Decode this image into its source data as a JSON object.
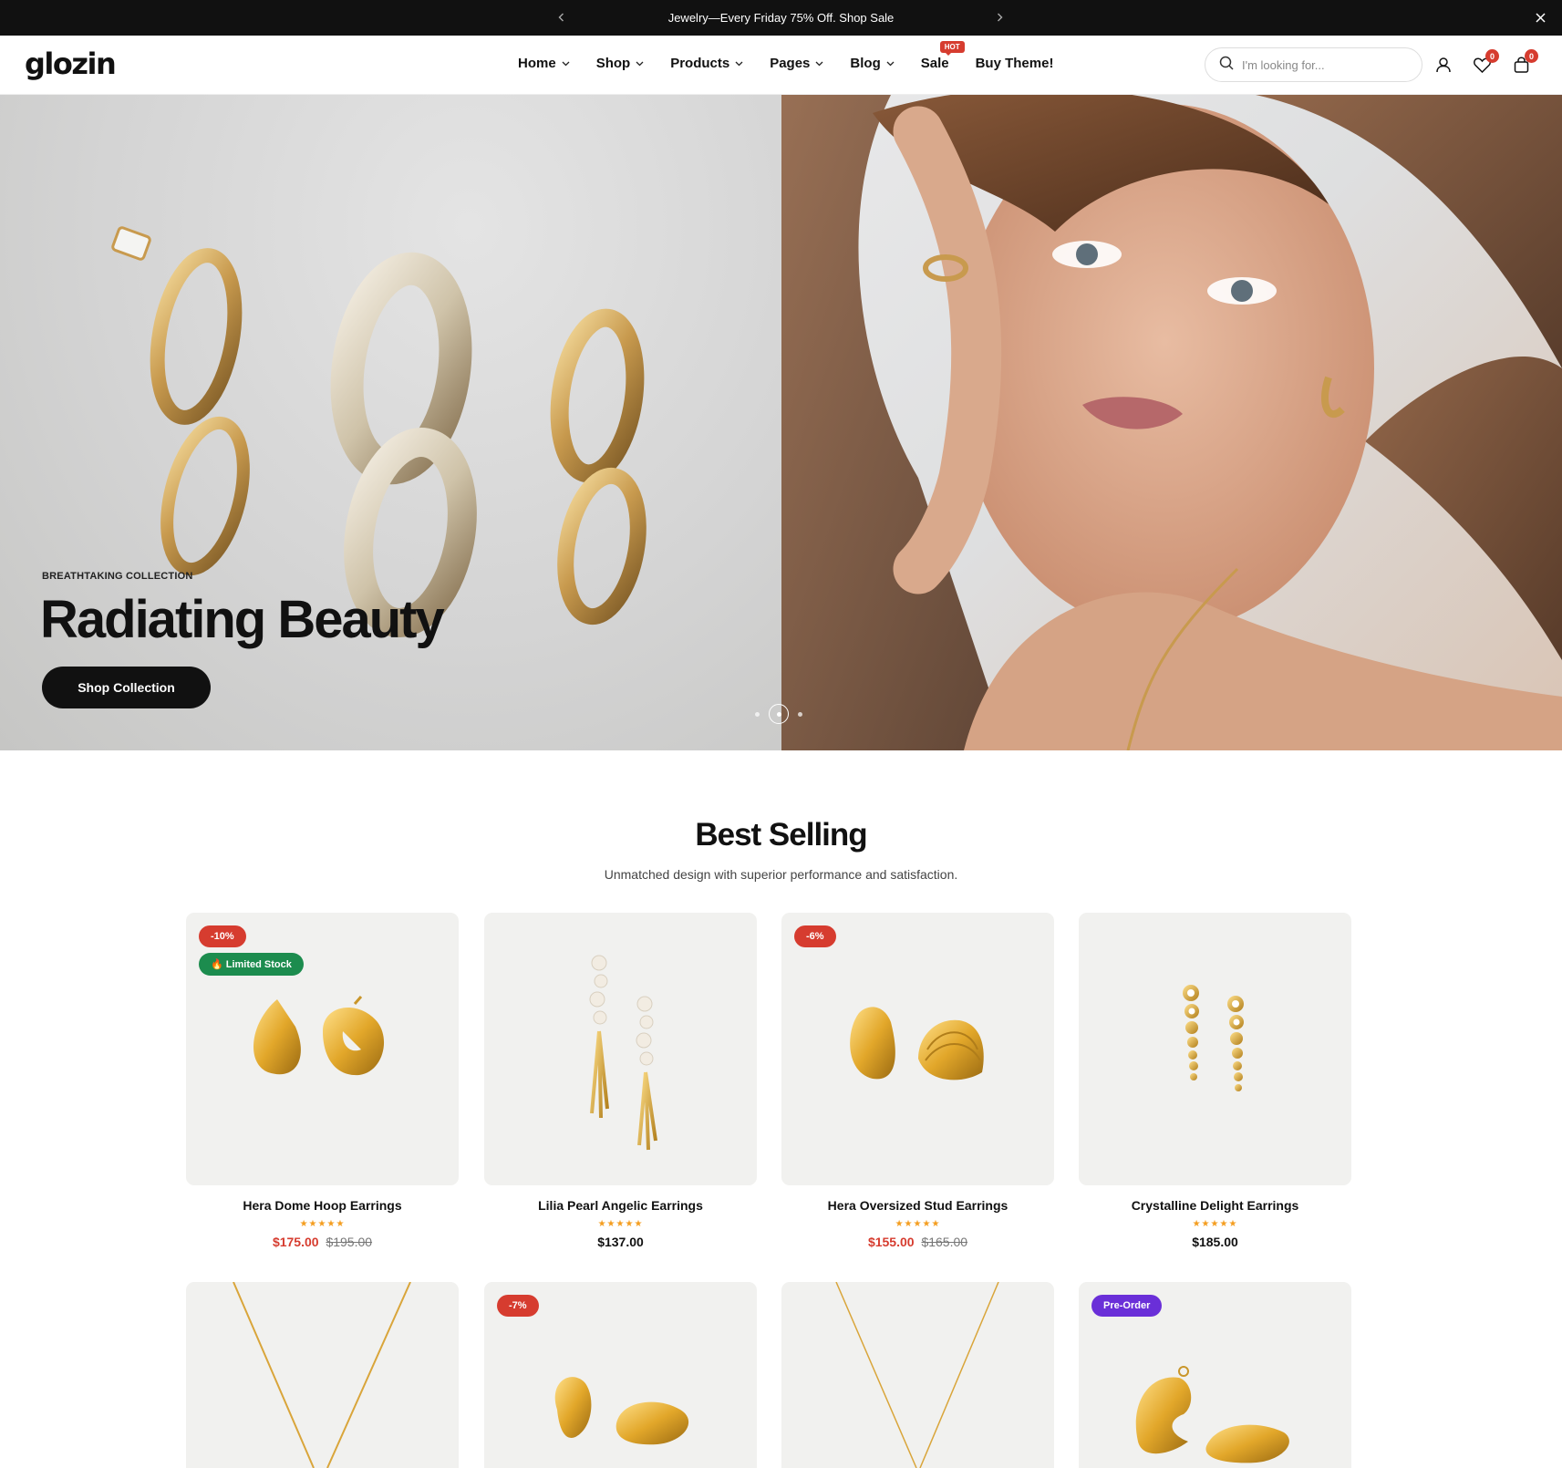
{
  "announcement": {
    "text": "Jewelry—Every Friday 75% Off. Shop Sale",
    "prev_icon": "chevron-left-icon",
    "next_icon": "chevron-right-icon",
    "close_icon": "close-icon"
  },
  "header": {
    "logo": "glozin",
    "nav": [
      {
        "label": "Home",
        "dropdown": true
      },
      {
        "label": "Shop",
        "dropdown": true
      },
      {
        "label": "Products",
        "dropdown": true
      },
      {
        "label": "Pages",
        "dropdown": true
      },
      {
        "label": "Blog",
        "dropdown": true
      },
      {
        "label": "Sale",
        "dropdown": false,
        "badge": "HOT"
      },
      {
        "label": "Buy Theme!",
        "dropdown": false
      }
    ],
    "search_placeholder": "I'm looking for...",
    "wishlist_count": "0",
    "cart_count": "0"
  },
  "hero": {
    "subtitle": "BREATHTAKING COLLECTION",
    "title": "Radiating Beauty",
    "button": "Shop Collection",
    "slides": 3,
    "active_slide": 2
  },
  "best_selling": {
    "title": "Best Selling",
    "subtitle": "Unmatched design with superior performance and satisfaction.",
    "products": [
      {
        "name": "Hera Dome Hoop Earrings",
        "price": "$175.00",
        "was": "$195.00",
        "badge": "-10%",
        "extra_badge": "🔥 Limited Stock",
        "rating": 5
      },
      {
        "name": "Lilia Pearl Angelic Earrings",
        "price": "$137.00",
        "was": "",
        "badge": "",
        "rating": 5
      },
      {
        "name": "Hera Oversized Stud Earrings",
        "price": "$155.00",
        "was": "$165.00",
        "badge": "-6%",
        "rating": 5
      },
      {
        "name": "Crystalline Delight Earrings",
        "price": "$185.00",
        "was": "",
        "badge": "",
        "rating": 5
      }
    ],
    "row2_badges": [
      "",
      "-7%",
      "",
      "Pre-Order"
    ]
  },
  "colors": {
    "accent_red": "#d63c2f",
    "stock_green": "#1c8c4e",
    "preorder_purple": "#6a2fd8",
    "star": "#f49e20"
  }
}
